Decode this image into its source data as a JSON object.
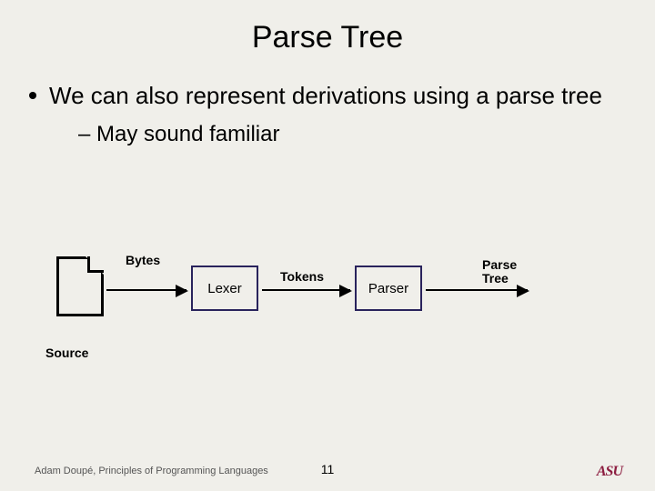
{
  "title": "Parse Tree",
  "bullets": {
    "main": "We can also represent derivations using a parse tree",
    "sub_prefix": "–",
    "sub": "May sound familiar"
  },
  "diagram": {
    "source_label": "Source",
    "arrow1_label": "Bytes",
    "box1": "Lexer",
    "arrow2_label": "Tokens",
    "box2": "Parser",
    "arrow3_label": "Parse Tree"
  },
  "footer": {
    "left": "Adam Doupé, Principles of Programming Languages",
    "number": "11",
    "logo_text": "ASU"
  }
}
